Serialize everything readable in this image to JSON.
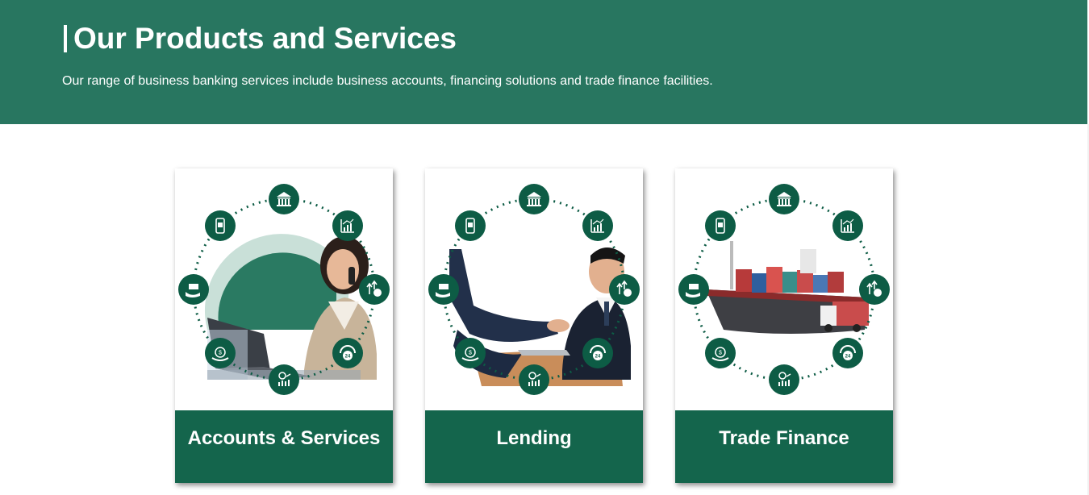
{
  "header": {
    "title": "Our Products and Services",
    "subtitle": "Our range of business banking services include business accounts, financing solutions and trade finance facilities."
  },
  "colors": {
    "banner": "#287660",
    "card_footer": "#14654c",
    "icon_circle": "#0d5c45"
  },
  "cards": [
    {
      "label": "Accounts & Services",
      "image": "woman-on-phone-with-laptop"
    },
    {
      "label": "Lending",
      "image": "business-handshake"
    },
    {
      "label": "Trade Finance",
      "image": "cargo-ship-and-truck"
    }
  ],
  "ring_icons": [
    "bank-icon",
    "chart-icon",
    "growth-coin-icon",
    "24h-support-icon",
    "user-chart-icon",
    "money-hand-icon",
    "cash-hand-icon",
    "mobile-icon"
  ]
}
